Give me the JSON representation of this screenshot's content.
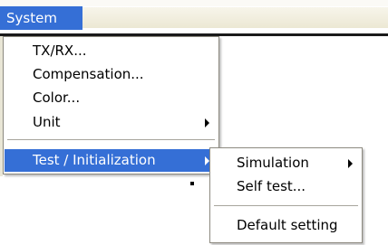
{
  "menubar": {
    "system_label": "System"
  },
  "system_menu": {
    "items": [
      {
        "label": "TX/RX..."
      },
      {
        "label": "Compensation..."
      },
      {
        "label": "Color..."
      },
      {
        "label": "Unit",
        "has_submenu": true
      },
      {
        "label": "Test / Initialization",
        "has_submenu": true,
        "highlighted": true
      }
    ]
  },
  "test_submenu": {
    "items": [
      {
        "label": "Simulation",
        "has_submenu": true
      },
      {
        "label": "Self test..."
      },
      {
        "label": "Default setting"
      }
    ]
  },
  "colors": {
    "highlight": "#356fd6"
  }
}
